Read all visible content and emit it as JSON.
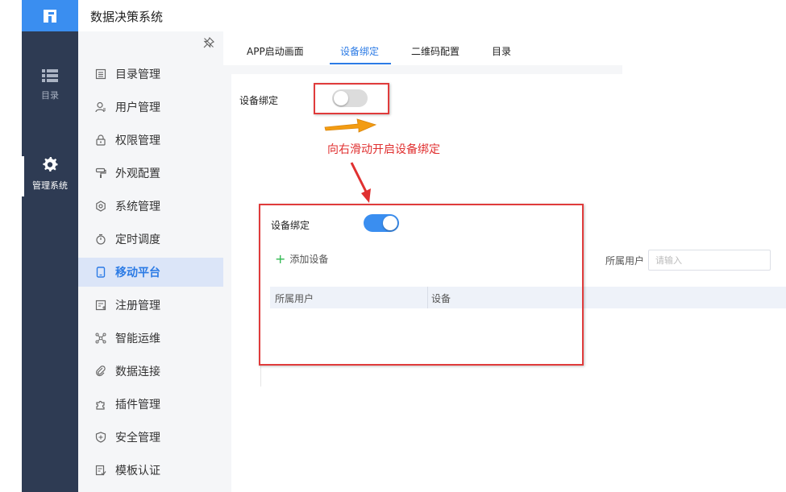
{
  "app": {
    "title": "数据决策系统"
  },
  "rail": {
    "items": [
      {
        "label": "目录",
        "icon": "list-icon"
      },
      {
        "label": "管理系统",
        "icon": "gear-icon"
      }
    ]
  },
  "menu": {
    "items": [
      {
        "label": "目录管理",
        "icon": "catalog-icon"
      },
      {
        "label": "用户管理",
        "icon": "user-icon"
      },
      {
        "label": "权限管理",
        "icon": "lock-icon"
      },
      {
        "label": "外观配置",
        "icon": "paint-roller-icon"
      },
      {
        "label": "系统管理",
        "icon": "settings-icon"
      },
      {
        "label": "定时调度",
        "icon": "timer-icon"
      },
      {
        "label": "移动平台",
        "icon": "tablet-icon",
        "active": true
      },
      {
        "label": "注册管理",
        "icon": "register-icon"
      },
      {
        "label": "智能运维",
        "icon": "network-icon"
      },
      {
        "label": "数据连接",
        "icon": "link-icon"
      },
      {
        "label": "插件管理",
        "icon": "puzzle-icon"
      },
      {
        "label": "安全管理",
        "icon": "shield-icon"
      },
      {
        "label": "模板认证",
        "icon": "template-icon"
      }
    ]
  },
  "tabs": [
    {
      "label": "APP启动画面"
    },
    {
      "label": "设备绑定",
      "active": true
    },
    {
      "label": "二维码配置"
    },
    {
      "label": "目录"
    }
  ],
  "device_binding": {
    "label": "设备绑定",
    "enabled": false
  },
  "annotation": {
    "instruction": "向右滑动开启设备绑定"
  },
  "enabled_preview": {
    "label": "设备绑定",
    "enabled": true,
    "add_button": "添加设备",
    "filter": {
      "label": "所属用户",
      "placeholder": "请输入"
    },
    "table": {
      "columns": [
        "所属用户",
        "设备"
      ],
      "rows": []
    }
  },
  "colors": {
    "accent": "#3a8ef0",
    "sidebar_dark": "#2e3b53",
    "highlight_red": "#e03b3b",
    "arrow_orange": "#f39c12",
    "add_green": "#2eb84f"
  }
}
